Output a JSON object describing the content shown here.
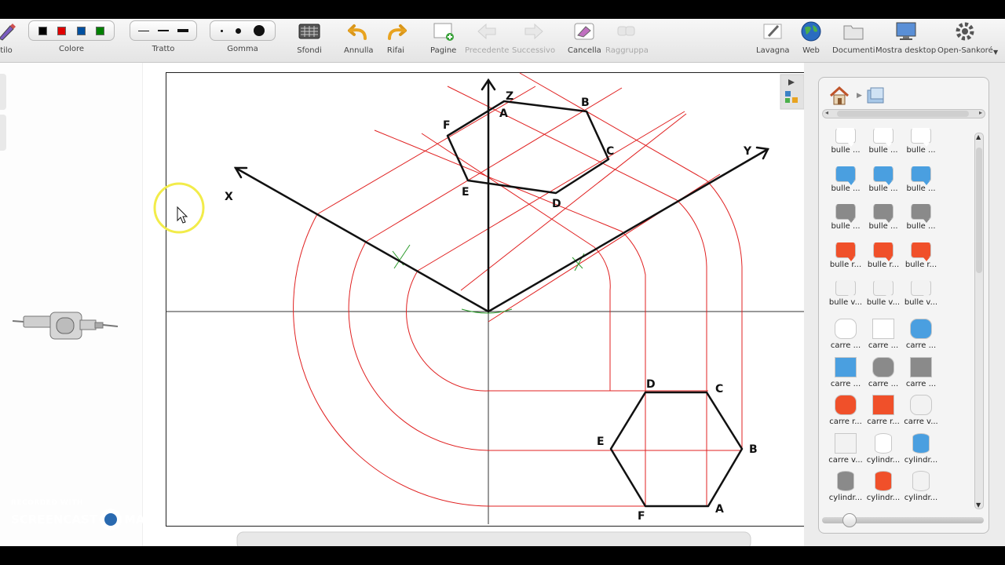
{
  "toolbar": {
    "stilo_label": "tilo",
    "colore": {
      "label": "Colore",
      "colors": [
        "#000000",
        "#e00000",
        "#0050a0",
        "#008000"
      ]
    },
    "tratto_label": "Tratto",
    "gomma_label": "Gomma",
    "sfondi_label": "Sfondi",
    "annulla_label": "Annulla",
    "rifai_label": "Rifai",
    "pagine_label": "Pagine",
    "precedente_label": "Precedente",
    "successivo_label": "Successivo",
    "cancella_label": "Cancella",
    "raggruppa_label": "Raggruppa",
    "lavagna_label": "Lavagna",
    "web_label": "Web",
    "documenti_label": "Documenti",
    "mostra_desktop_label": "Mostra desktop",
    "open_sankore_label": "Open-Sankoré"
  },
  "drawing": {
    "axis_labels": {
      "x": "X",
      "y": "Y",
      "z": "Z"
    },
    "top_hex_labels": [
      "A",
      "B",
      "C",
      "D",
      "E",
      "F"
    ],
    "bottom_hex_labels": [
      "A",
      "B",
      "C",
      "D",
      "E",
      "F"
    ]
  },
  "library": {
    "items": [
      {
        "label": "bulle ...",
        "shape": "bubble",
        "color": "#ffffff"
      },
      {
        "label": "bulle ...",
        "shape": "bubble",
        "color": "#ffffff"
      },
      {
        "label": "bulle ...",
        "shape": "bubble",
        "color": "#ffffff"
      },
      {
        "label": "bulle ...",
        "shape": "bubble",
        "color": "#4a9fe0"
      },
      {
        "label": "bulle ...",
        "shape": "bubble",
        "color": "#4a9fe0"
      },
      {
        "label": "bulle ...",
        "shape": "bubble",
        "color": "#4a9fe0"
      },
      {
        "label": "bulle ...",
        "shape": "bubble",
        "color": "#8a8a8a"
      },
      {
        "label": "bulle ...",
        "shape": "bubble",
        "color": "#8a8a8a"
      },
      {
        "label": "bulle ...",
        "shape": "bubble",
        "color": "#8a8a8a"
      },
      {
        "label": "bulle r...",
        "shape": "bubble",
        "color": "#f0502a"
      },
      {
        "label": "bulle r...",
        "shape": "bubble",
        "color": "#f0502a"
      },
      {
        "label": "bulle r...",
        "shape": "bubble",
        "color": "#f0502a"
      },
      {
        "label": "bulle v...",
        "shape": "bubble",
        "color": "#f2f2f2"
      },
      {
        "label": "bulle v...",
        "shape": "bubble",
        "color": "#f2f2f2"
      },
      {
        "label": "bulle v...",
        "shape": "bubble",
        "color": "#f2f2f2"
      },
      {
        "label": "carre ...",
        "shape": "rect-round",
        "color": "#ffffff"
      },
      {
        "label": "carre ...",
        "shape": "rect",
        "color": "#ffffff"
      },
      {
        "label": "carre ...",
        "shape": "rect-round",
        "color": "#4a9fe0"
      },
      {
        "label": "carre ...",
        "shape": "rect",
        "color": "#4a9fe0"
      },
      {
        "label": "carre ...",
        "shape": "rect-round",
        "color": "#8a8a8a"
      },
      {
        "label": "carre ...",
        "shape": "rect",
        "color": "#8a8a8a"
      },
      {
        "label": "carre r...",
        "shape": "rect-round",
        "color": "#f0502a"
      },
      {
        "label": "carre r...",
        "shape": "rect",
        "color": "#f0502a"
      },
      {
        "label": "carre v...",
        "shape": "rect-round",
        "color": "#f2f2f2"
      },
      {
        "label": "carre v...",
        "shape": "rect",
        "color": "#f2f2f2"
      },
      {
        "label": "cylindr...",
        "shape": "cyl",
        "color": "#ffffff"
      },
      {
        "label": "cylindr...",
        "shape": "cyl",
        "color": "#4a9fe0"
      },
      {
        "label": "cylindr...",
        "shape": "cyl",
        "color": "#8a8a8a"
      },
      {
        "label": "cylindr...",
        "shape": "cyl",
        "color": "#f0502a"
      },
      {
        "label": "cylindr...",
        "shape": "cyl",
        "color": "#f2f2f2"
      }
    ]
  },
  "watermark": {
    "line1": "RECORDED WITH",
    "line2a": "SCREENCAST",
    "line2b": "MATIC"
  }
}
